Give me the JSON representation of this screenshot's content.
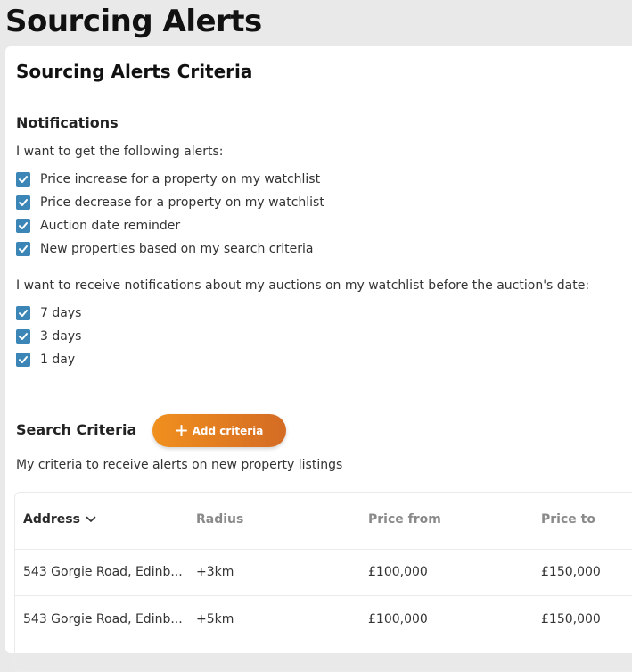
{
  "page": {
    "title": "Sourcing Alerts"
  },
  "card": {
    "title": "Sourcing Alerts Criteria"
  },
  "notifications": {
    "title": "Notifications",
    "intro": "I want to get the following alerts:",
    "alerts": [
      {
        "label": "Price increase for a property on my watchlist",
        "checked": true
      },
      {
        "label": "Price decrease for a property on my watchlist",
        "checked": true
      },
      {
        "label": "Auction date reminder",
        "checked": true
      },
      {
        "label": "New properties based on my search criteria",
        "checked": true
      }
    ],
    "auction_intro": "I want to receive notifications about my auctions on my watchlist before the auction's date:",
    "auction_options": [
      {
        "label": "7 days",
        "checked": true
      },
      {
        "label": "3 days",
        "checked": true
      },
      {
        "label": "1 day",
        "checked": true
      }
    ]
  },
  "search_criteria": {
    "title": "Search Criteria",
    "add_button_label": "Add criteria",
    "description": "My criteria to receive alerts on new property listings",
    "table": {
      "columns": [
        "Address",
        "Radius",
        "Price from",
        "Price to"
      ],
      "rows": [
        [
          "543 Gorgie Road, Edinb...",
          "+3km",
          "£100,000",
          "£150,000"
        ],
        [
          "543 Gorgie Road, Edinb...",
          "+5km",
          "£100,000",
          "£150,000"
        ]
      ]
    }
  },
  "colors": {
    "checkbox": "#3b86b7",
    "button_start": "#f0901e",
    "button_end": "#d46b24"
  }
}
